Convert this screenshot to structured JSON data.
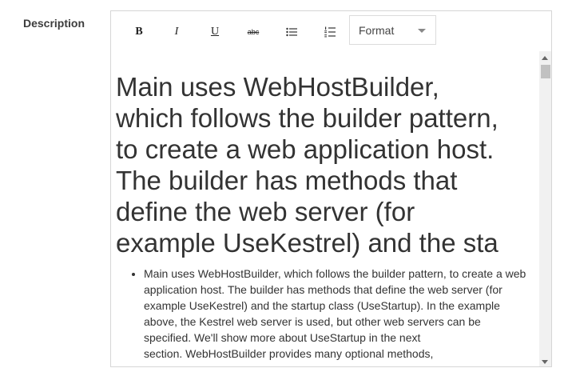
{
  "field": {
    "label": "Description"
  },
  "toolbar": {
    "bold": {
      "label": "B",
      "icon": "bold-icon"
    },
    "italic": {
      "label": "I",
      "icon": "italic-icon"
    },
    "underline": {
      "label": "U",
      "icon": "underline-icon"
    },
    "strikethrough": {
      "label": "abc",
      "icon": "strikethrough-icon"
    },
    "bullet_list": {
      "icon": "bulleted-list-icon"
    },
    "numbered_list": {
      "icon": "numbered-list-icon"
    },
    "format": {
      "label": "Format",
      "icon": "chevron-down-icon"
    }
  },
  "content": {
    "heading_lines": [
      "Main uses WebHostBuilder,",
      "which follows the builder pattern,",
      "to create a web application host.",
      "The builder has methods that",
      "define the web server (for",
      "example UseKestrel) and the sta"
    ],
    "list_item_lines": [
      "Main uses WebHostBuilder, which follows the builder pattern, to create a web",
      "application host. The builder has methods that define the web server (for",
      "example UseKestrel) and the startup class (UseStartup). In the example",
      "above, the Kestrel web server is used, but other web servers can be",
      "specified. We'll show more about UseStartup in the next",
      "section. WebHostBuilder provides many optional methods,"
    ]
  },
  "colors": {
    "border": "#d6d6d6",
    "text": "#333333",
    "scrollbar_track": "#f1f1f1",
    "scrollbar_thumb": "#c1c1c1"
  }
}
